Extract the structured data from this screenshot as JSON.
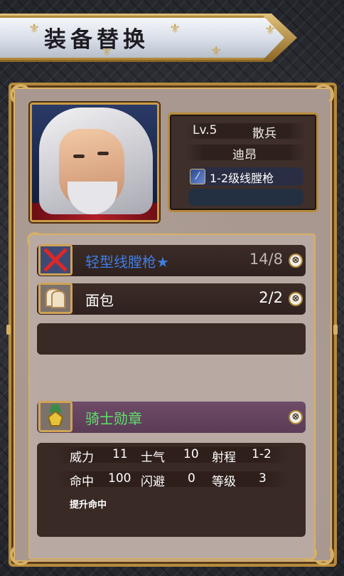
{
  "header": {
    "title": "装备替换"
  },
  "unit": {
    "level": "Lv.5",
    "class": "散兵",
    "name": "迪昂",
    "weapon_label": "1-2级线膛枪",
    "weapon_icon": "musket-icon",
    "portrait": "white-haired-nobleman"
  },
  "items": [
    {
      "name": "轻型线膛枪★",
      "count": "14/8",
      "color": "#3f7ee0",
      "icon": "broken-musket-icon",
      "count_dim": true
    },
    {
      "name": "面包",
      "count": "2/2",
      "color": "#ffffff",
      "icon": "bread-icon",
      "count_dim": false
    }
  ],
  "accessory": {
    "name": "骑士勋章",
    "color": "#5fe06a",
    "icon": "medal-icon"
  },
  "stats": {
    "row1": [
      {
        "label": "威力",
        "value": "11"
      },
      {
        "label": "士气",
        "value": "10"
      },
      {
        "label": "射程",
        "value": "1-2"
      }
    ],
    "row2": [
      {
        "label": "命中",
        "value": "100"
      },
      {
        "label": "闪避",
        "value": "0"
      },
      {
        "label": "等级",
        "value": "3"
      }
    ],
    "description": "提升命中"
  },
  "remove_glyph": "⊗"
}
